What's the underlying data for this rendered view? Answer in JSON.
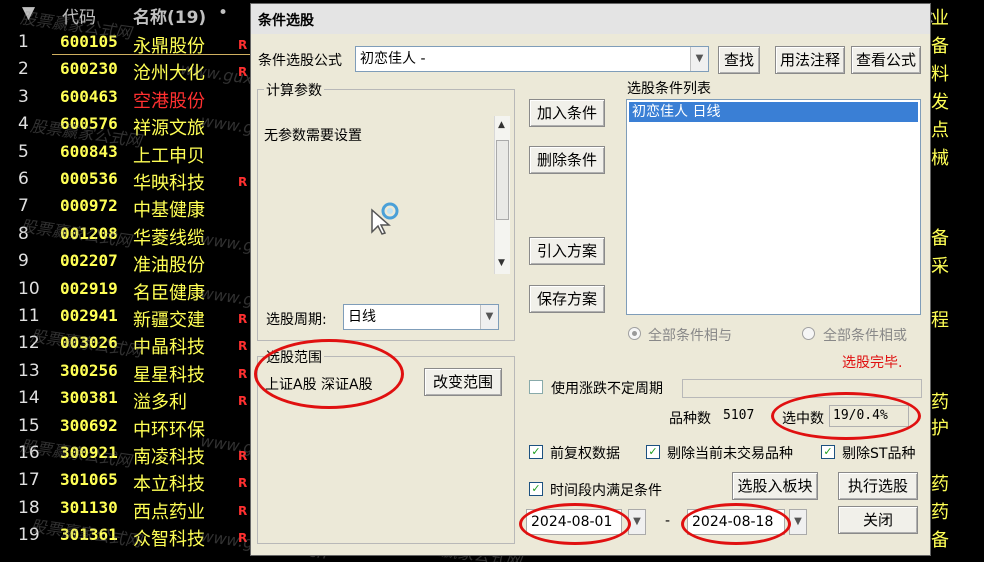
{
  "list": {
    "header": {
      "code": "代码",
      "name": "名称(19)",
      "dot": "•"
    },
    "rows": [
      {
        "idx": "1",
        "code": "600105",
        "name": "永鼎股份",
        "mark": "R",
        "red": false
      },
      {
        "idx": "2",
        "code": "600230",
        "name": "沧州大化",
        "mark": "R",
        "red": false
      },
      {
        "idx": "3",
        "code": "600463",
        "name": "空港股份",
        "mark": "",
        "red": true
      },
      {
        "idx": "4",
        "code": "600576",
        "name": "祥源文旅",
        "mark": "",
        "red": false
      },
      {
        "idx": "5",
        "code": "600843",
        "name": "上工申贝",
        "mark": "",
        "red": false
      },
      {
        "idx": "6",
        "code": "000536",
        "name": "华映科技",
        "mark": "R",
        "red": false
      },
      {
        "idx": "7",
        "code": "000972",
        "name": "中基健康",
        "mark": "",
        "red": false
      },
      {
        "idx": "8",
        "code": "001208",
        "name": "华菱线缆",
        "mark": "",
        "red": false
      },
      {
        "idx": "9",
        "code": "002207",
        "name": "准油股份",
        "mark": "",
        "red": false
      },
      {
        "idx": "10",
        "code": "002919",
        "name": "名臣健康",
        "mark": "",
        "red": false
      },
      {
        "idx": "11",
        "code": "002941",
        "name": "新疆交建",
        "mark": "R",
        "red": false
      },
      {
        "idx": "12",
        "code": "003026",
        "name": "中晶科技",
        "mark": "R",
        "red": false
      },
      {
        "idx": "13",
        "code": "300256",
        "name": "星星科技",
        "mark": "R",
        "red": false
      },
      {
        "idx": "14",
        "code": "300381",
        "name": "溢多利",
        "mark": "R",
        "red": false
      },
      {
        "idx": "15",
        "code": "300692",
        "name": "中环环保",
        "mark": "",
        "red": false
      },
      {
        "idx": "16",
        "code": "300921",
        "name": "南凌科技",
        "mark": "R",
        "red": false
      },
      {
        "idx": "17",
        "code": "301065",
        "name": "本立科技",
        "mark": "R",
        "red": false
      },
      {
        "idx": "18",
        "code": "301130",
        "name": "西点药业",
        "mark": "R",
        "red": false
      },
      {
        "idx": "19",
        "code": "301361",
        "name": "众智科技",
        "mark": "R",
        "red": false
      }
    ],
    "right_chars": [
      "业",
      "备",
      "料",
      "发",
      "点",
      "械",
      "备",
      "采",
      "程",
      "药",
      "护",
      "药",
      "药",
      "备"
    ]
  },
  "watermark": {
    "cn": "股票赢家公式网",
    "url": "www.guxueB.cn"
  },
  "dialog": {
    "title": "条件选股",
    "formula_label": "条件选股公式",
    "formula_value": "初恋佳人  -",
    "btn_find": "查找",
    "btn_usage": "用法注释",
    "btn_view": "查看公式",
    "params_group": "计算参数",
    "params_text": "无参数需要设置",
    "period_label": "选股周期:",
    "period_value": "日线",
    "range_group": "选股范围",
    "range_value": "上证A股  深证A股",
    "btn_change_range": "改变范围",
    "btn_add": "加入条件",
    "btn_delete": "删除条件",
    "btn_import": "引入方案",
    "btn_save": "保存方案",
    "conditions_label": "选股条件列表",
    "conditions": [
      "初恋佳人  日线"
    ],
    "radio_and": "全部条件相与",
    "radio_or": "全部条件相或",
    "status": "选股完毕.",
    "status_color": "#e01010",
    "chk_unfixed": "使用涨跌不定周期",
    "count_label": "品种数",
    "count_value": "5107",
    "selected_label": "选中数",
    "selected_value": "19/0.4%",
    "chk_fq": "前复权数据",
    "chk_exclude_untraded": "剔除当前未交易品种",
    "chk_exclude_st": "剔除ST品种",
    "chk_period": "时间段内满足条件",
    "btn_to_block": "选股入板块",
    "btn_execute": "执行选股",
    "date_from": "2024-08-01",
    "date_to": "2024-08-18",
    "date_sep": "-",
    "btn_close": "关闭"
  },
  "colors": {
    "highlight": "#e01010",
    "selection": "#3a7fd5",
    "stock_code": "#ffff55"
  }
}
